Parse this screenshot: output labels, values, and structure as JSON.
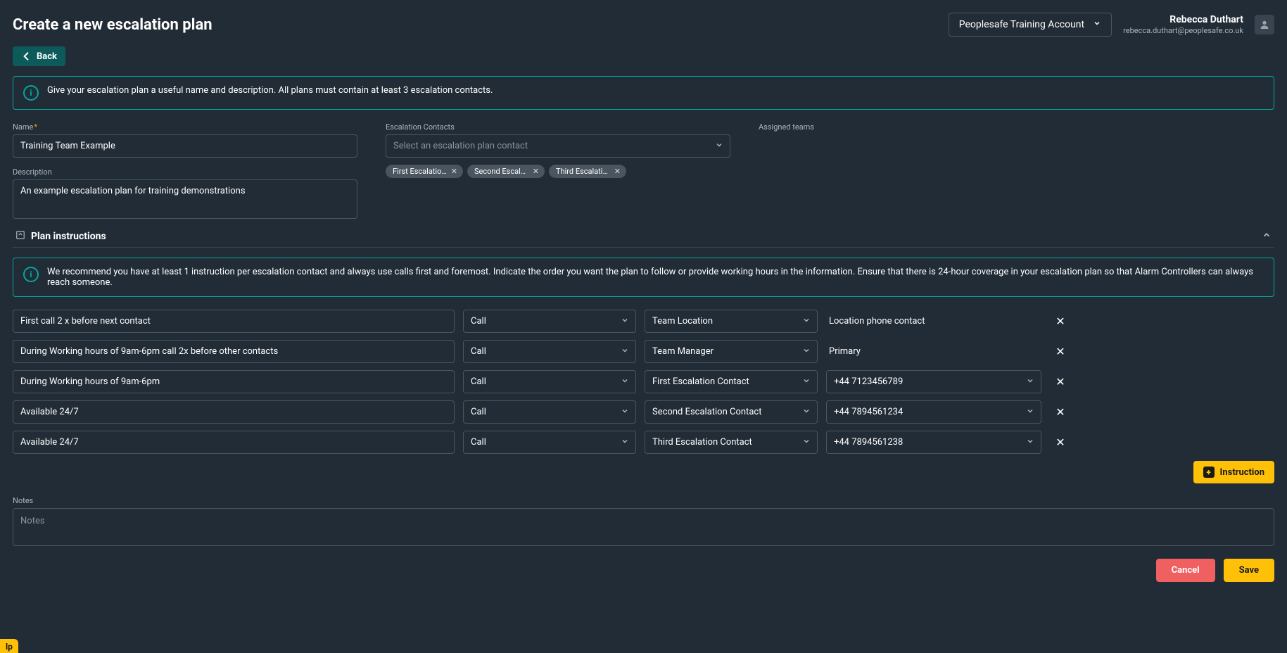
{
  "header": {
    "title": "Create a new escalation plan",
    "account_selector": "Peoplesafe Training Account",
    "user_name": "Rebecca Duthart",
    "user_email": "rebecca.duthart@peoplesafe.co.uk",
    "back_label": "Back"
  },
  "banners": {
    "intro": "Give your escalation plan a useful name and description. All plans must contain at least 3 escalation contacts.",
    "plan_instructions": "We recommend you have at least 1 instruction per escalation contact and always use calls first and foremost. Indicate the order you want the plan to follow or provide working hours in the information. Ensure that there is 24-hour coverage in your escalation plan so that Alarm Controllers can always reach someone."
  },
  "form": {
    "name_label": "Name",
    "name_value": "Training Team Example",
    "description_label": "Description",
    "description_value": "An example escalation plan for training demonstrations",
    "escalation_contacts_label": "Escalation Contacts",
    "escalation_contacts_placeholder": "Select an escalation plan contact",
    "assigned_teams_label": "Assigned teams",
    "chips": [
      "First Escalation C...",
      "Second Escalatio...",
      "Third Escalation ..."
    ]
  },
  "section": {
    "plan_instructions_title": "Plan instructions"
  },
  "instructions": [
    {
      "desc": "First call 2 x before next contact",
      "method": "Call",
      "contact": "Team Location",
      "phone_mode": "text",
      "phone": "Location phone contact"
    },
    {
      "desc": "During Working hours of 9am-6pm call 2x before other contacts",
      "method": "Call",
      "contact": "Team Manager",
      "phone_mode": "text",
      "phone": "Primary"
    },
    {
      "desc": "During Working hours of 9am-6pm",
      "method": "Call",
      "contact": "First Escalation Contact",
      "phone_mode": "select",
      "phone": "+44 7123456789"
    },
    {
      "desc": "Available 24/7",
      "method": "Call",
      "contact": "Second Escalation Contact",
      "phone_mode": "select",
      "phone": "+44 7894561234"
    },
    {
      "desc": "Available 24/7",
      "method": "Call",
      "contact": "Third Escalation Contact",
      "phone_mode": "select",
      "phone": "+44 7894561238"
    }
  ],
  "actions": {
    "add_instruction": "Instruction",
    "cancel": "Cancel",
    "save": "Save"
  },
  "notes": {
    "label": "Notes",
    "placeholder": "Notes",
    "value": ""
  },
  "help_tab": "lp"
}
